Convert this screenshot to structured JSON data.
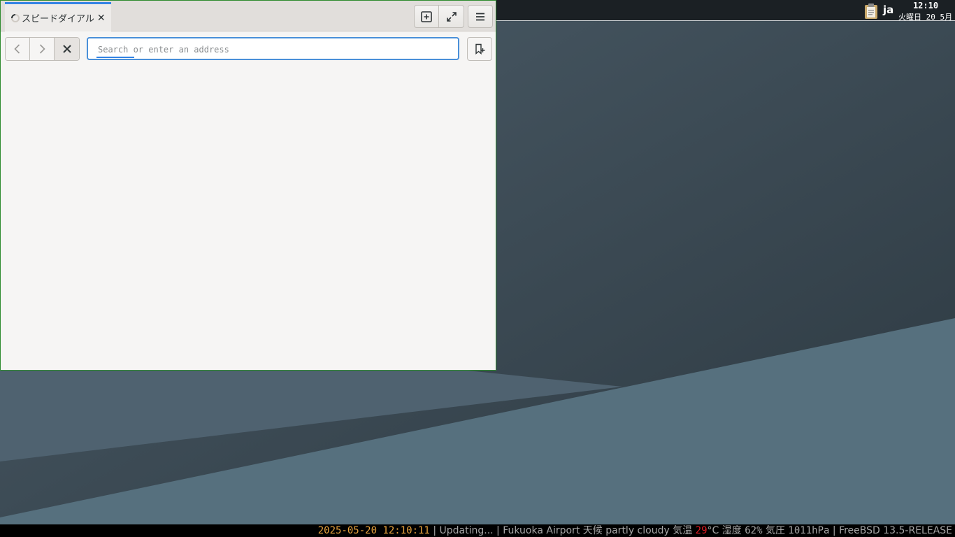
{
  "panel": {
    "language": "ja",
    "clock_time": "12:10",
    "clock_date": "火曜日 20 5月"
  },
  "browser": {
    "tab_title": "スピードダイアル",
    "url_placeholder": "Search or enter an address",
    "url_value": ""
  },
  "statusbar": {
    "datetime": "2025-05-20 12:10:11",
    "sep1": " | ",
    "updating": "Updating...",
    "sep2": " | ",
    "location": "Fukuoka Airport",
    "weather_label": "天候",
    "weather": "partly cloudy",
    "temp_label": "気温",
    "temp_value": "29",
    "temp_unit": "°C",
    "humidity_label": "湿度",
    "humidity_value": "62%",
    "pressure_label": "気圧",
    "pressure_value": "1011hPa",
    "sep3": " | ",
    "os": "FreeBSD 13.5-RELEASE"
  },
  "colors": {
    "accent": "#3584e4",
    "window_border": "#2e8b2e",
    "datetime": "#e8a33d",
    "temperature": "#e01b24"
  }
}
